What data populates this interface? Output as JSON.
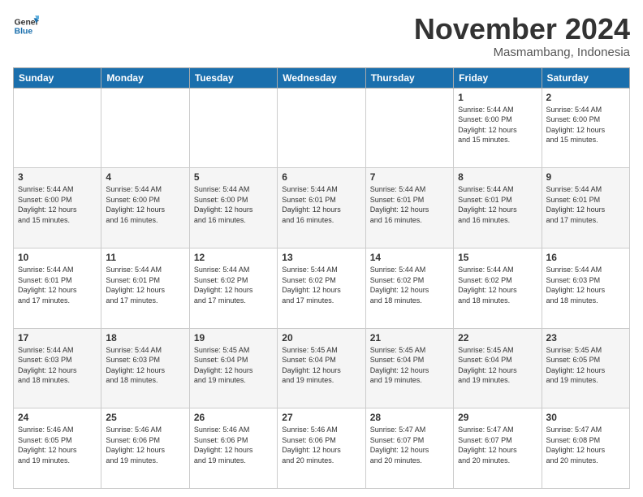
{
  "header": {
    "logo_line1": "General",
    "logo_line2": "Blue",
    "month_title": "November 2024",
    "location": "Masmambang, Indonesia"
  },
  "weekdays": [
    "Sunday",
    "Monday",
    "Tuesday",
    "Wednesday",
    "Thursday",
    "Friday",
    "Saturday"
  ],
  "weeks": [
    [
      {
        "day": "",
        "info": ""
      },
      {
        "day": "",
        "info": ""
      },
      {
        "day": "",
        "info": ""
      },
      {
        "day": "",
        "info": ""
      },
      {
        "day": "",
        "info": ""
      },
      {
        "day": "1",
        "info": "Sunrise: 5:44 AM\nSunset: 6:00 PM\nDaylight: 12 hours\nand 15 minutes."
      },
      {
        "day": "2",
        "info": "Sunrise: 5:44 AM\nSunset: 6:00 PM\nDaylight: 12 hours\nand 15 minutes."
      }
    ],
    [
      {
        "day": "3",
        "info": "Sunrise: 5:44 AM\nSunset: 6:00 PM\nDaylight: 12 hours\nand 15 minutes."
      },
      {
        "day": "4",
        "info": "Sunrise: 5:44 AM\nSunset: 6:00 PM\nDaylight: 12 hours\nand 16 minutes."
      },
      {
        "day": "5",
        "info": "Sunrise: 5:44 AM\nSunset: 6:00 PM\nDaylight: 12 hours\nand 16 minutes."
      },
      {
        "day": "6",
        "info": "Sunrise: 5:44 AM\nSunset: 6:01 PM\nDaylight: 12 hours\nand 16 minutes."
      },
      {
        "day": "7",
        "info": "Sunrise: 5:44 AM\nSunset: 6:01 PM\nDaylight: 12 hours\nand 16 minutes."
      },
      {
        "day": "8",
        "info": "Sunrise: 5:44 AM\nSunset: 6:01 PM\nDaylight: 12 hours\nand 16 minutes."
      },
      {
        "day": "9",
        "info": "Sunrise: 5:44 AM\nSunset: 6:01 PM\nDaylight: 12 hours\nand 17 minutes."
      }
    ],
    [
      {
        "day": "10",
        "info": "Sunrise: 5:44 AM\nSunset: 6:01 PM\nDaylight: 12 hours\nand 17 minutes."
      },
      {
        "day": "11",
        "info": "Sunrise: 5:44 AM\nSunset: 6:01 PM\nDaylight: 12 hours\nand 17 minutes."
      },
      {
        "day": "12",
        "info": "Sunrise: 5:44 AM\nSunset: 6:02 PM\nDaylight: 12 hours\nand 17 minutes."
      },
      {
        "day": "13",
        "info": "Sunrise: 5:44 AM\nSunset: 6:02 PM\nDaylight: 12 hours\nand 17 minutes."
      },
      {
        "day": "14",
        "info": "Sunrise: 5:44 AM\nSunset: 6:02 PM\nDaylight: 12 hours\nand 18 minutes."
      },
      {
        "day": "15",
        "info": "Sunrise: 5:44 AM\nSunset: 6:02 PM\nDaylight: 12 hours\nand 18 minutes."
      },
      {
        "day": "16",
        "info": "Sunrise: 5:44 AM\nSunset: 6:03 PM\nDaylight: 12 hours\nand 18 minutes."
      }
    ],
    [
      {
        "day": "17",
        "info": "Sunrise: 5:44 AM\nSunset: 6:03 PM\nDaylight: 12 hours\nand 18 minutes."
      },
      {
        "day": "18",
        "info": "Sunrise: 5:44 AM\nSunset: 6:03 PM\nDaylight: 12 hours\nand 18 minutes."
      },
      {
        "day": "19",
        "info": "Sunrise: 5:45 AM\nSunset: 6:04 PM\nDaylight: 12 hours\nand 19 minutes."
      },
      {
        "day": "20",
        "info": "Sunrise: 5:45 AM\nSunset: 6:04 PM\nDaylight: 12 hours\nand 19 minutes."
      },
      {
        "day": "21",
        "info": "Sunrise: 5:45 AM\nSunset: 6:04 PM\nDaylight: 12 hours\nand 19 minutes."
      },
      {
        "day": "22",
        "info": "Sunrise: 5:45 AM\nSunset: 6:04 PM\nDaylight: 12 hours\nand 19 minutes."
      },
      {
        "day": "23",
        "info": "Sunrise: 5:45 AM\nSunset: 6:05 PM\nDaylight: 12 hours\nand 19 minutes."
      }
    ],
    [
      {
        "day": "24",
        "info": "Sunrise: 5:46 AM\nSunset: 6:05 PM\nDaylight: 12 hours\nand 19 minutes."
      },
      {
        "day": "25",
        "info": "Sunrise: 5:46 AM\nSunset: 6:06 PM\nDaylight: 12 hours\nand 19 minutes."
      },
      {
        "day": "26",
        "info": "Sunrise: 5:46 AM\nSunset: 6:06 PM\nDaylight: 12 hours\nand 19 minutes."
      },
      {
        "day": "27",
        "info": "Sunrise: 5:46 AM\nSunset: 6:06 PM\nDaylight: 12 hours\nand 20 minutes."
      },
      {
        "day": "28",
        "info": "Sunrise: 5:47 AM\nSunset: 6:07 PM\nDaylight: 12 hours\nand 20 minutes."
      },
      {
        "day": "29",
        "info": "Sunrise: 5:47 AM\nSunset: 6:07 PM\nDaylight: 12 hours\nand 20 minutes."
      },
      {
        "day": "30",
        "info": "Sunrise: 5:47 AM\nSunset: 6:08 PM\nDaylight: 12 hours\nand 20 minutes."
      }
    ]
  ]
}
